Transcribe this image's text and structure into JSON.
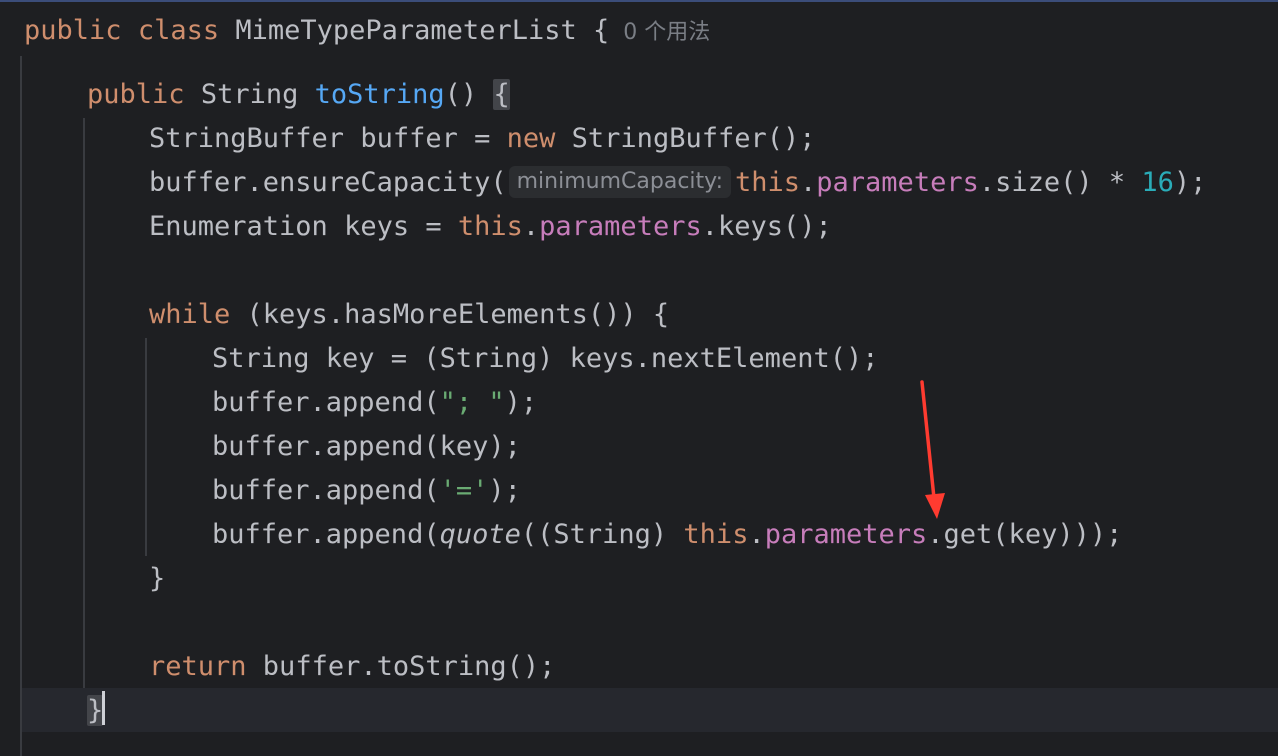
{
  "editor": {
    "class_line": {
      "kw_public": "public",
      "kw_class": "class",
      "class_name": "MimeTypeParameterList",
      "open_brace": "{",
      "usages_hint": "0 个用法"
    },
    "method_line": {
      "kw_public": "public",
      "type": "String",
      "method_name": "toString",
      "parens": "()",
      "open_brace": "{"
    },
    "line3": {
      "text": "StringBuffer buffer = ",
      "kw_new": "new",
      "rest": " StringBuffer();"
    },
    "line4": {
      "pre": "buffer.ensureCapacity(",
      "param_hint": "minimumCapacity:",
      "kw_this": "this",
      "dot": ".",
      "field": "parameters",
      "mid": ".size() * ",
      "number": "16",
      "end": ");"
    },
    "line5": {
      "pre": "Enumeration keys = ",
      "kw_this": "this",
      "dot": ".",
      "field": "parameters",
      "end": ".keys();"
    },
    "line7": {
      "kw_while": "while",
      "rest": " (keys.hasMoreElements()) {"
    },
    "line8": {
      "text": "String key = (String) keys.nextElement();"
    },
    "line9": {
      "pre": "buffer.append(",
      "string": "\"; \"",
      "end": ");"
    },
    "line10": {
      "text": "buffer.append(key);"
    },
    "line11": {
      "pre": "buffer.append(",
      "string": "'='",
      "end": ");"
    },
    "line12": {
      "pre": "buffer.append(",
      "fn_quote": "quote",
      "mid": "((String) ",
      "kw_this": "this",
      "dot": ".",
      "field": "parameters",
      "end": ".get(key)));"
    },
    "line13": {
      "text": "}"
    },
    "line15": {
      "kw_return": "return",
      "rest": " buffer.toString();"
    },
    "line16": {
      "text": "}"
    }
  },
  "colors": {
    "background": "#1e1f22",
    "keyword": "#cf8e6d",
    "method_declaration": "#56a8f5",
    "field": "#c77dbb",
    "number": "#2aacb8",
    "string": "#6aab73",
    "default_text": "#bcbec4",
    "annotation_arrow": "#ff3b30"
  }
}
